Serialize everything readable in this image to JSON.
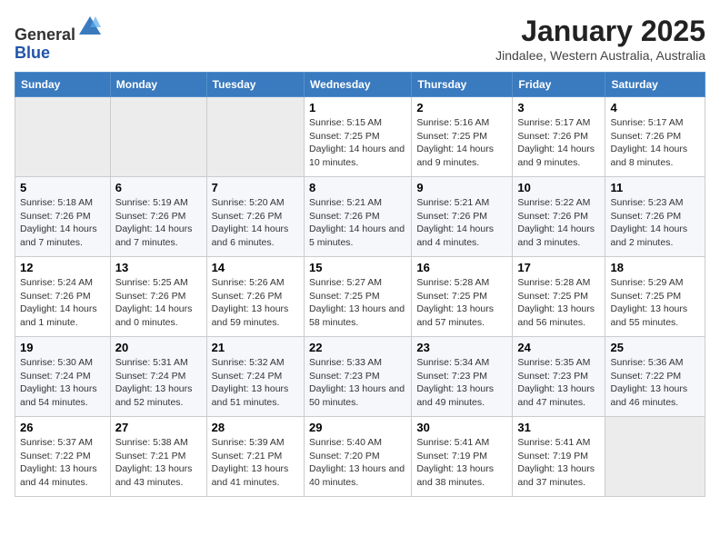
{
  "header": {
    "logo_general": "General",
    "logo_blue": "Blue",
    "title": "January 2025",
    "subtitle": "Jindalee, Western Australia, Australia"
  },
  "days_of_week": [
    "Sunday",
    "Monday",
    "Tuesday",
    "Wednesday",
    "Thursday",
    "Friday",
    "Saturday"
  ],
  "weeks": [
    [
      {
        "day": "",
        "empty": true
      },
      {
        "day": "",
        "empty": true
      },
      {
        "day": "",
        "empty": true
      },
      {
        "day": "1",
        "sunrise": "5:15 AM",
        "sunset": "7:25 PM",
        "daylight": "14 hours and 10 minutes."
      },
      {
        "day": "2",
        "sunrise": "5:16 AM",
        "sunset": "7:25 PM",
        "daylight": "14 hours and 9 minutes."
      },
      {
        "day": "3",
        "sunrise": "5:17 AM",
        "sunset": "7:26 PM",
        "daylight": "14 hours and 9 minutes."
      },
      {
        "day": "4",
        "sunrise": "5:17 AM",
        "sunset": "7:26 PM",
        "daylight": "14 hours and 8 minutes."
      }
    ],
    [
      {
        "day": "5",
        "sunrise": "5:18 AM",
        "sunset": "7:26 PM",
        "daylight": "14 hours and 7 minutes."
      },
      {
        "day": "6",
        "sunrise": "5:19 AM",
        "sunset": "7:26 PM",
        "daylight": "14 hours and 7 minutes."
      },
      {
        "day": "7",
        "sunrise": "5:20 AM",
        "sunset": "7:26 PM",
        "daylight": "14 hours and 6 minutes."
      },
      {
        "day": "8",
        "sunrise": "5:21 AM",
        "sunset": "7:26 PM",
        "daylight": "14 hours and 5 minutes."
      },
      {
        "day": "9",
        "sunrise": "5:21 AM",
        "sunset": "7:26 PM",
        "daylight": "14 hours and 4 minutes."
      },
      {
        "day": "10",
        "sunrise": "5:22 AM",
        "sunset": "7:26 PM",
        "daylight": "14 hours and 3 minutes."
      },
      {
        "day": "11",
        "sunrise": "5:23 AM",
        "sunset": "7:26 PM",
        "daylight": "14 hours and 2 minutes."
      }
    ],
    [
      {
        "day": "12",
        "sunrise": "5:24 AM",
        "sunset": "7:26 PM",
        "daylight": "14 hours and 1 minute."
      },
      {
        "day": "13",
        "sunrise": "5:25 AM",
        "sunset": "7:26 PM",
        "daylight": "14 hours and 0 minutes."
      },
      {
        "day": "14",
        "sunrise": "5:26 AM",
        "sunset": "7:26 PM",
        "daylight": "13 hours and 59 minutes."
      },
      {
        "day": "15",
        "sunrise": "5:27 AM",
        "sunset": "7:25 PM",
        "daylight": "13 hours and 58 minutes."
      },
      {
        "day": "16",
        "sunrise": "5:28 AM",
        "sunset": "7:25 PM",
        "daylight": "13 hours and 57 minutes."
      },
      {
        "day": "17",
        "sunrise": "5:28 AM",
        "sunset": "7:25 PM",
        "daylight": "13 hours and 56 minutes."
      },
      {
        "day": "18",
        "sunrise": "5:29 AM",
        "sunset": "7:25 PM",
        "daylight": "13 hours and 55 minutes."
      }
    ],
    [
      {
        "day": "19",
        "sunrise": "5:30 AM",
        "sunset": "7:24 PM",
        "daylight": "13 hours and 54 minutes."
      },
      {
        "day": "20",
        "sunrise": "5:31 AM",
        "sunset": "7:24 PM",
        "daylight": "13 hours and 52 minutes."
      },
      {
        "day": "21",
        "sunrise": "5:32 AM",
        "sunset": "7:24 PM",
        "daylight": "13 hours and 51 minutes."
      },
      {
        "day": "22",
        "sunrise": "5:33 AM",
        "sunset": "7:23 PM",
        "daylight": "13 hours and 50 minutes."
      },
      {
        "day": "23",
        "sunrise": "5:34 AM",
        "sunset": "7:23 PM",
        "daylight": "13 hours and 49 minutes."
      },
      {
        "day": "24",
        "sunrise": "5:35 AM",
        "sunset": "7:23 PM",
        "daylight": "13 hours and 47 minutes."
      },
      {
        "day": "25",
        "sunrise": "5:36 AM",
        "sunset": "7:22 PM",
        "daylight": "13 hours and 46 minutes."
      }
    ],
    [
      {
        "day": "26",
        "sunrise": "5:37 AM",
        "sunset": "7:22 PM",
        "daylight": "13 hours and 44 minutes."
      },
      {
        "day": "27",
        "sunrise": "5:38 AM",
        "sunset": "7:21 PM",
        "daylight": "13 hours and 43 minutes."
      },
      {
        "day": "28",
        "sunrise": "5:39 AM",
        "sunset": "7:21 PM",
        "daylight": "13 hours and 41 minutes."
      },
      {
        "day": "29",
        "sunrise": "5:40 AM",
        "sunset": "7:20 PM",
        "daylight": "13 hours and 40 minutes."
      },
      {
        "day": "30",
        "sunrise": "5:41 AM",
        "sunset": "7:19 PM",
        "daylight": "13 hours and 38 minutes."
      },
      {
        "day": "31",
        "sunrise": "5:41 AM",
        "sunset": "7:19 PM",
        "daylight": "13 hours and 37 minutes."
      },
      {
        "day": "",
        "empty": true
      }
    ]
  ],
  "labels": {
    "sunrise": "Sunrise:",
    "sunset": "Sunset:",
    "daylight": "Daylight:"
  }
}
